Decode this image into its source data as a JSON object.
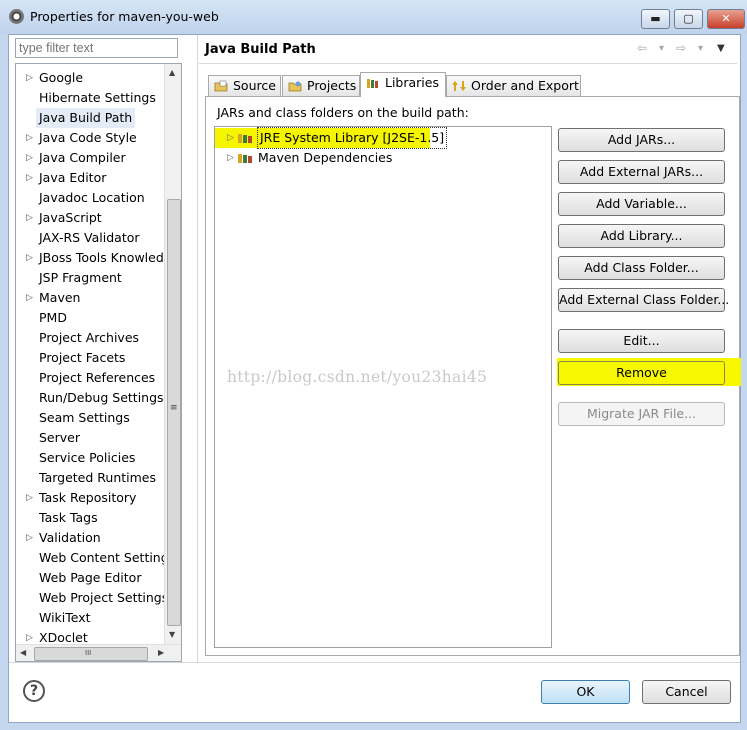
{
  "window": {
    "title": "Properties for maven-you-web",
    "controls": {
      "minimize": "▬",
      "maximize": "▢",
      "close": "✕"
    }
  },
  "filter": {
    "placeholder": "type filter text"
  },
  "nav": {
    "items": [
      {
        "label": "Google",
        "arrow": "▷"
      },
      {
        "label": "Hibernate Settings",
        "arrow": ""
      },
      {
        "label": "Java Build Path",
        "arrow": "",
        "selected": true
      },
      {
        "label": "Java Code Style",
        "arrow": "▷"
      },
      {
        "label": "Java Compiler",
        "arrow": "▷"
      },
      {
        "label": "Java Editor",
        "arrow": "▷"
      },
      {
        "label": "Javadoc Location",
        "arrow": ""
      },
      {
        "label": "JavaScript",
        "arrow": "▷"
      },
      {
        "label": "JAX-RS Validator",
        "arrow": ""
      },
      {
        "label": "JBoss Tools Knowledge",
        "arrow": "▷"
      },
      {
        "label": "JSP Fragment",
        "arrow": ""
      },
      {
        "label": "Maven",
        "arrow": "▷"
      },
      {
        "label": "PMD",
        "arrow": ""
      },
      {
        "label": "Project Archives",
        "arrow": ""
      },
      {
        "label": "Project Facets",
        "arrow": ""
      },
      {
        "label": "Project References",
        "arrow": ""
      },
      {
        "label": "Run/Debug Settings",
        "arrow": ""
      },
      {
        "label": "Seam Settings",
        "arrow": ""
      },
      {
        "label": "Server",
        "arrow": ""
      },
      {
        "label": "Service Policies",
        "arrow": ""
      },
      {
        "label": "Targeted Runtimes",
        "arrow": ""
      },
      {
        "label": "Task Repository",
        "arrow": "▷"
      },
      {
        "label": "Task Tags",
        "arrow": ""
      },
      {
        "label": "Validation",
        "arrow": "▷"
      },
      {
        "label": "Web Content Settings",
        "arrow": ""
      },
      {
        "label": "Web Page Editor",
        "arrow": ""
      },
      {
        "label": "Web Project Settings",
        "arrow": ""
      },
      {
        "label": "WikiText",
        "arrow": ""
      },
      {
        "label": "XDoclet",
        "arrow": "▷"
      }
    ]
  },
  "scroll": {
    "up": "▲",
    "down": "▼",
    "left": "◀",
    "right": "▶",
    "grip": "≡",
    "hgrip": "III"
  },
  "header": {
    "title": "Java Build Path",
    "back": "⇦",
    "back_menu": "▾",
    "forward": "⇨",
    "forward_menu": "▾",
    "view_menu": "▼"
  },
  "tabs": [
    {
      "label": "Source",
      "icon": "source-folder-icon"
    },
    {
      "label": "Projects",
      "icon": "projects-icon"
    },
    {
      "label": "Libraries",
      "icon": "libraries-icon",
      "active": true
    },
    {
      "label": "Order and Export",
      "icon": "order-export-icon"
    }
  ],
  "panel": {
    "caption": "JARs and class folders on the build path:"
  },
  "libraries": [
    {
      "label": "JRE System Library [J2SE-1.5]",
      "arrow": "▷",
      "highlighted": true
    },
    {
      "label": "Maven Dependencies",
      "arrow": "▷"
    }
  ],
  "buttons": {
    "add_jars": "Add JARs...",
    "add_external_jars": "Add External JARs...",
    "add_variable": "Add Variable...",
    "add_library": "Add Library...",
    "add_class_folder": "Add Class Folder...",
    "add_external_class_folder": "Add External Class Folder...",
    "edit": "Edit...",
    "remove": "Remove",
    "migrate_jar": "Migrate JAR File..."
  },
  "watermark": "http://blog.csdn.net/you23hai45",
  "footer": {
    "help": "?",
    "ok": "OK",
    "cancel": "Cancel"
  },
  "colors": {
    "highlight": "#f7f700",
    "accent": "#3c7fb1"
  }
}
